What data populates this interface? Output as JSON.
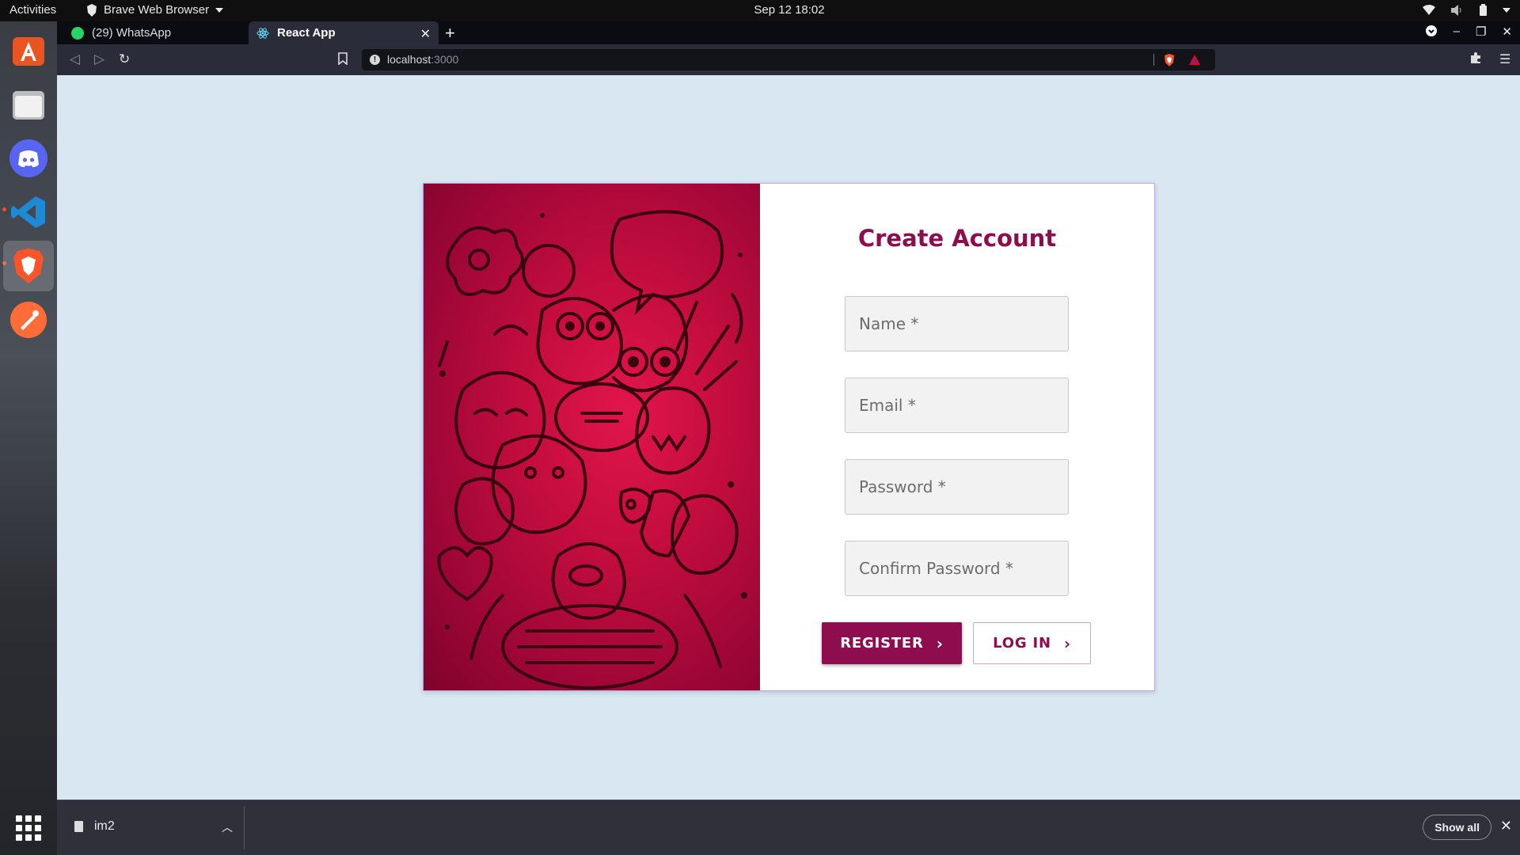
{
  "topbar": {
    "activities": "Activities",
    "app_name": "Brave Web Browser",
    "clock": "Sep 12  18:02"
  },
  "dock": {
    "items": [
      "ubuntu-software-icon",
      "files-icon",
      "discord-icon",
      "vscode-icon",
      "brave-icon",
      "postman-icon"
    ],
    "apps_grid": "show-applications-icon"
  },
  "browser": {
    "tabs": [
      {
        "label": "(29) WhatsApp",
        "icon": "whatsapp-icon"
      },
      {
        "label": "React App",
        "icon": "react-icon"
      }
    ],
    "url_host": "localhost",
    "url_port": ":3000"
  },
  "form": {
    "title": "Create Account",
    "fields": {
      "name": "Name *",
      "email": "Email *",
      "password": "Password *",
      "confirm": "Confirm Password *"
    },
    "register_label": "REGISTER",
    "login_label": "LOG IN"
  },
  "downloads": {
    "file_name": "im2",
    "show_all": "Show all"
  },
  "colors": {
    "accent": "#8d0d4f",
    "page_bg": "#d8e7f2",
    "art_red": "#c40d3f"
  }
}
